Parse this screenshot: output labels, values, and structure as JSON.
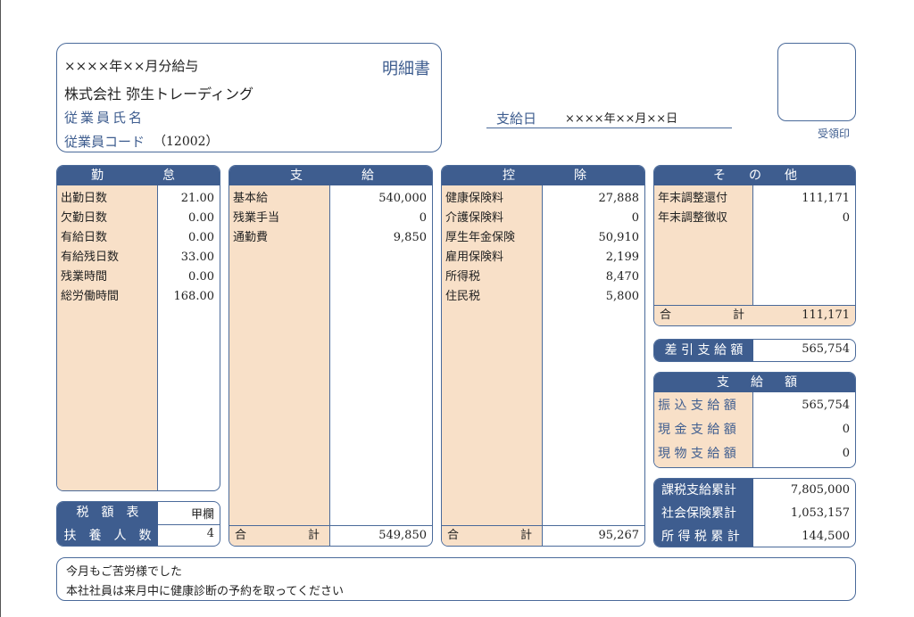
{
  "header": {
    "title_line": "××××年××月分給与",
    "statement": "明細書",
    "company": "株式会社 弥生トレーディング",
    "employee_name_label": "従業員氏名",
    "employee_code_label": "従業員コード",
    "employee_code": "（12002）",
    "pay_date_label": "支給日",
    "pay_date": "××××年××月××日",
    "receipt_label": "受領印"
  },
  "attendance": {
    "title_left": "勤",
    "title_right": "怠",
    "rows": [
      {
        "label": "出勤日数",
        "value": "21.00"
      },
      {
        "label": "欠勤日数",
        "value": "0.00"
      },
      {
        "label": "有給日数",
        "value": "0.00"
      },
      {
        "label": "有給残日数",
        "value": "33.00"
      },
      {
        "label": "残業時間",
        "value": "0.00"
      },
      {
        "label": "総労働時間",
        "value": "168.00"
      }
    ]
  },
  "tax_table": {
    "label": "税　額　表",
    "value": "甲欄",
    "dep_label": "扶　養　人　数",
    "dep_value": "4"
  },
  "payments": {
    "title_left": "支",
    "title_right": "給",
    "rows": [
      {
        "label": "基本給",
        "value": "540,000"
      },
      {
        "label": "残業手当",
        "value": "0"
      },
      {
        "label": "通勤費",
        "value": "9,850"
      }
    ],
    "total_label_left": "合",
    "total_label_right": "計",
    "total": "549,850"
  },
  "deductions": {
    "title_left": "控",
    "title_right": "除",
    "rows": [
      {
        "label": "健康保険料",
        "value": "27,888"
      },
      {
        "label": "介護保険料",
        "value": "0"
      },
      {
        "label": "厚生年金保険",
        "value": "50,910"
      },
      {
        "label": "雇用保険料",
        "value": "2,199"
      },
      {
        "label": "所得税",
        "value": "8,470"
      },
      {
        "label": "住民税",
        "value": "5,800"
      }
    ],
    "total_label_left": "合",
    "total_label_right": "計",
    "total": "95,267"
  },
  "other": {
    "title_a": "そ",
    "title_b": "の",
    "title_c": "他",
    "rows": [
      {
        "label": "年末調整還付",
        "value": "111,171"
      },
      {
        "label": "年末調整徴収",
        "value": "0"
      }
    ],
    "total_label_left": "合",
    "total_label_right": "計",
    "total": "111,171"
  },
  "net_pay": {
    "label": "差 引 支 給 額",
    "value": "565,754"
  },
  "payout": {
    "title_a": "支",
    "title_b": "給",
    "title_c": "額",
    "rows": [
      {
        "label": "振 込 支 給 額",
        "value": "565,754"
      },
      {
        "label": "現 金 支 給 額",
        "value": "0"
      },
      {
        "label": "現 物 支 給 額",
        "value": "0"
      }
    ]
  },
  "cumulative": [
    {
      "label": "課税支給累計",
      "value": "7,805,000"
    },
    {
      "label": "社会保険累計",
      "value": "1,053,157"
    },
    {
      "label": "所 得 税 累 計",
      "value": "144,500"
    }
  ],
  "message": {
    "line1": "今月もご苦労様でした",
    "line2": "本社社員は来月中に健康診断の予約を取ってください"
  }
}
